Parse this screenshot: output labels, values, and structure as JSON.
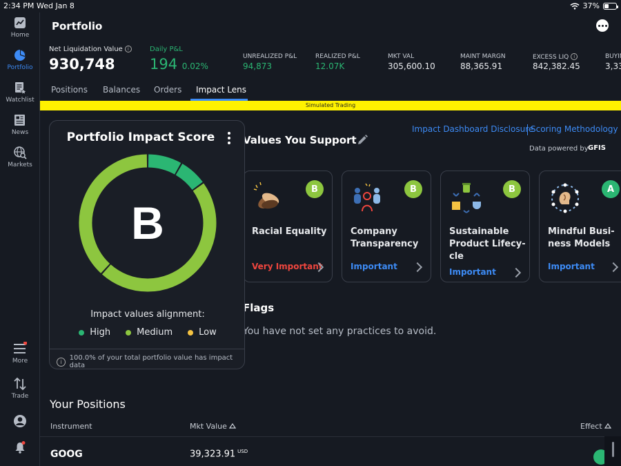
{
  "status_bar": {
    "time": "2:34 PM",
    "date": "Wed Jan 8",
    "battery": "37%",
    "wifi_icon": "wifi-icon",
    "battery_icon": "battery-icon"
  },
  "sidebar": {
    "items": [
      {
        "label": "Home",
        "icon": "chart-icon"
      },
      {
        "label": "Portfolio",
        "icon": "pie-chart-icon"
      },
      {
        "label": "Watchlist",
        "icon": "watchlist-icon"
      },
      {
        "label": "News",
        "icon": "news-icon"
      },
      {
        "label": "Markets",
        "icon": "globe-search-icon"
      },
      {
        "label": "More",
        "icon": "menu-icon"
      },
      {
        "label": "Trade",
        "icon": "trade-arrows-icon"
      }
    ],
    "active": "Portfolio",
    "accent_color": "#3d8bf5"
  },
  "header": {
    "title": "Portfolio",
    "net_liq_label": "Net Liquidation Value",
    "net_liq_value": "930,748",
    "daily_pnl_label": "Daily P&L",
    "daily_pnl_value": "194",
    "daily_pnl_pct": "0.02%",
    "stats": [
      {
        "label": "UNREALIZED P&L",
        "value": "94,873"
      },
      {
        "label": "REALIZED P&L",
        "value": "12.07K"
      },
      {
        "label": "MKT VAL",
        "value": "305,600.10"
      },
      {
        "label": "MAINT MARGN",
        "value": "88,365.91"
      },
      {
        "label": "EXCESS LIQ",
        "value": "842,382.45"
      },
      {
        "label": "BUYIN",
        "value": "3,33"
      }
    ]
  },
  "tabs": [
    "Positions",
    "Balances",
    "Orders",
    "Impact Lens"
  ],
  "active_tab": "Impact Lens",
  "banner": "Simulated Trading",
  "score_card": {
    "title": "Portfolio Impact Score",
    "grade": "B",
    "alignment_label": "Impact values alignment:",
    "legend": [
      {
        "label": "High",
        "color": "#2bb673"
      },
      {
        "label": "Medium",
        "color": "#8dc63f"
      },
      {
        "label": "Low",
        "color": "#f5c342"
      }
    ],
    "alignment_shares": {
      "High": 0.15,
      "Medium": 0.85,
      "Low": 0.0
    },
    "coverage_text": "100.0% of your total portfolio value has impact data"
  },
  "values": {
    "title": "Values You Support",
    "disclosure_link": "Impact Dashboard Disclosure",
    "methodology_link": "Scoring Methodology",
    "powered_by": "Data powered by",
    "provider": "GFIS",
    "cards": [
      {
        "name": "Racial Equality",
        "grade": "B",
        "importance": "Very Important",
        "icon": "racial-equality-hands-icon"
      },
      {
        "name": "Company Transparency",
        "grade": "B",
        "importance": "Important",
        "icon": "company-transparency-people-icon"
      },
      {
        "name": "Sustainable Product Lifecy-cle",
        "grade": "B",
        "importance": "Important",
        "icon": "recycle-lifecycle-icon"
      },
      {
        "name": "Mindful Busi-ness Models",
        "grade": "A",
        "importance": "Important",
        "icon": "mindful-head-icon"
      }
    ]
  },
  "flags": {
    "title": "Flags",
    "empty_text": "You have not set any practices to avoid."
  },
  "positions": {
    "title": "Your Positions",
    "columns": [
      "Instrument",
      "Mkt Value",
      "Effect"
    ],
    "rows": [
      {
        "symbol": "GOOG",
        "mkt_value": "39,323.91",
        "currency": "USD"
      }
    ]
  }
}
